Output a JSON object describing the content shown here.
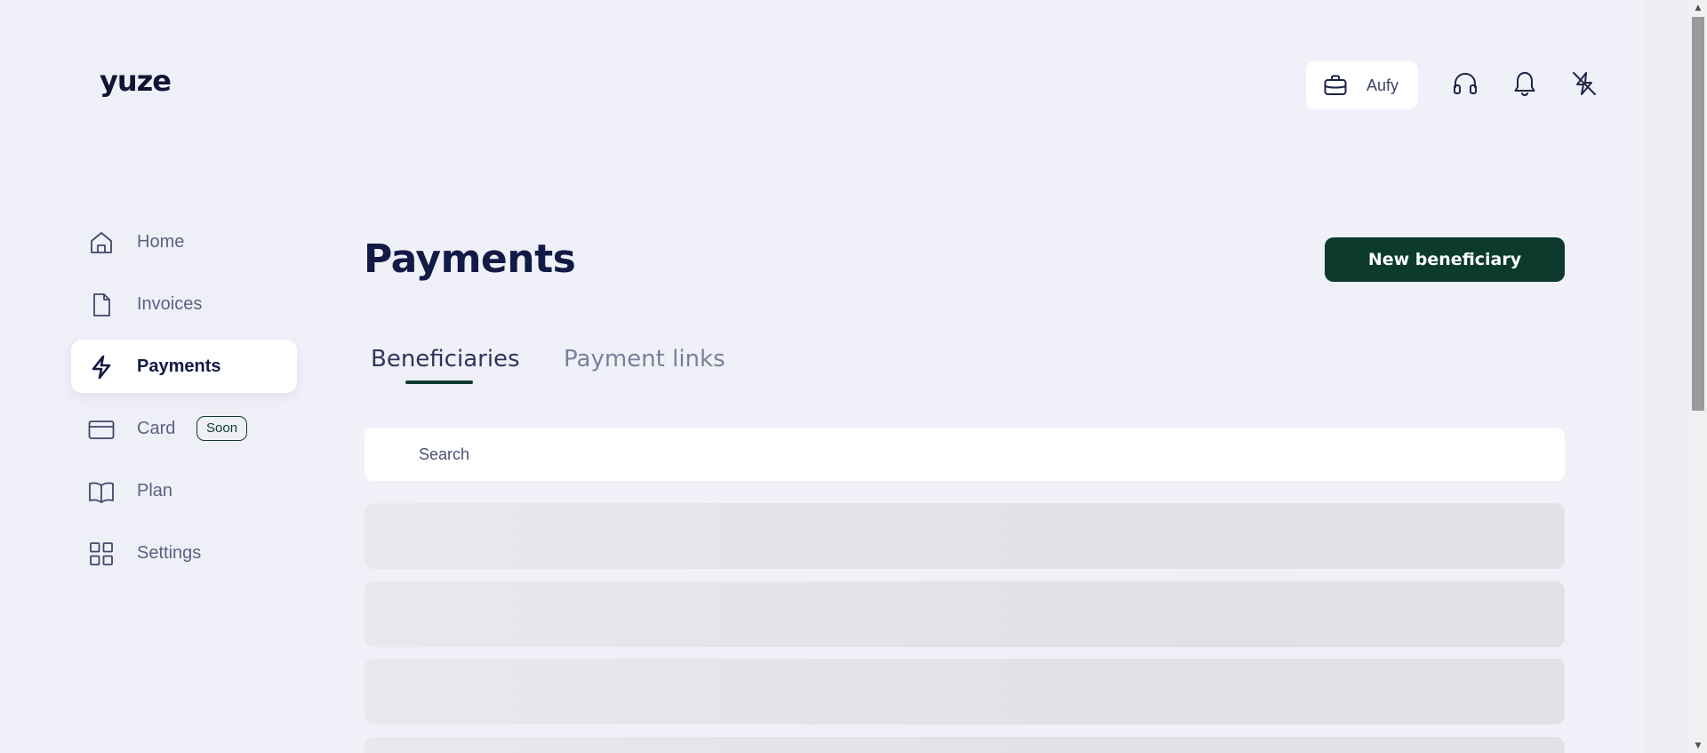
{
  "brand": {
    "logo_text": "yuze"
  },
  "sidebar": {
    "items": [
      {
        "label": "Home",
        "icon": "home-icon",
        "active": false
      },
      {
        "label": "Invoices",
        "icon": "document-icon",
        "active": false
      },
      {
        "label": "Payments",
        "icon": "lightning-icon",
        "active": true
      },
      {
        "label": "Card",
        "icon": "credit-card-icon",
        "active": false,
        "badge": "Soon"
      },
      {
        "label": "Plan",
        "icon": "book-icon",
        "active": false
      },
      {
        "label": "Settings",
        "icon": "grid-icon",
        "active": false
      }
    ]
  },
  "header": {
    "company_label": "Aufy",
    "company_icon": "briefcase-icon",
    "support_icon": "headphones-icon",
    "notifications_icon": "bell-icon",
    "lightning_off_icon": "lightning-off-icon"
  },
  "main": {
    "title": "Payments",
    "primary_action": "New beneficiary",
    "tabs": [
      {
        "label": "Beneficiaries",
        "active": true
      },
      {
        "label": "Payment links",
        "active": false
      }
    ],
    "search": {
      "placeholder": "Search",
      "value": ""
    },
    "loading_rows": 4
  },
  "colors": {
    "accent": "#0c3b2e",
    "text_primary": "#131a45",
    "background": "#f0f1f8",
    "surface": "#ffffff"
  }
}
